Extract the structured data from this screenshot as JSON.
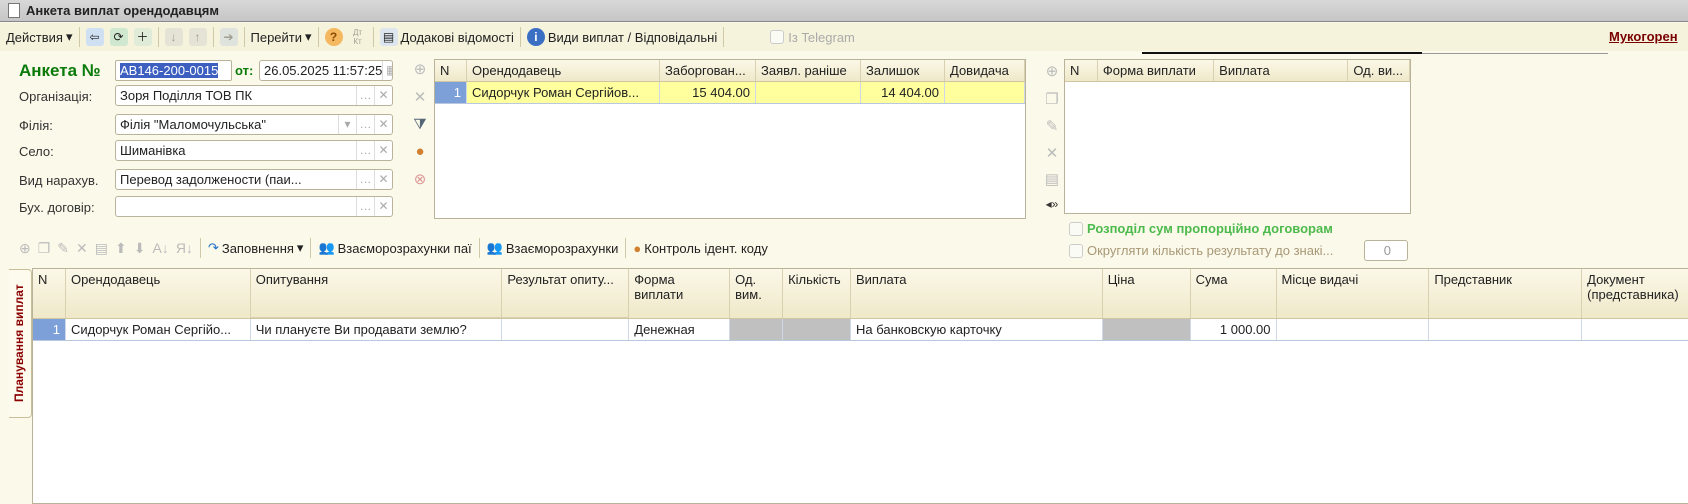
{
  "window": {
    "title": "Анкета виплат орендодавцям"
  },
  "toolbar": {
    "actions": "Действия",
    "goto": "Перейти",
    "dt_kt": "Дт Кт",
    "extra_info": "Додакові відомості",
    "payment_types": "Види виплат / Відповідальні",
    "telegram": "Із Telegram",
    "right_link": "Мукогорен"
  },
  "form": {
    "title": "Анкета №",
    "number": "АВ146-200-0015",
    "date_label": "от:",
    "date": "26.05.2025 11:57:25",
    "fields": [
      {
        "label": "Організація:",
        "value": "Зоря Поділля ТОВ ПК"
      },
      {
        "label": "Філія:",
        "value": "Філія \"Маломочульська\""
      },
      {
        "label": "Село:",
        "value": "Шиманівка"
      },
      {
        "label": "Вид нарахув.",
        "value": "Перевод задолжености (паи..."
      },
      {
        "label": "Бух. договір:",
        "value": ""
      }
    ]
  },
  "top_table": {
    "columns": [
      "N",
      "Орендодавець",
      "Заборгован...",
      "Заявл. раніше",
      "Залишок",
      "Довидача"
    ],
    "rows": [
      [
        "1",
        "Сидорчук Роман Сергійов...",
        "15 404.00",
        "",
        "14 404.00",
        ""
      ]
    ]
  },
  "right_table": {
    "columns": [
      "N",
      "Форма виплати",
      "Виплата",
      "Од. ви..."
    ],
    "rows": []
  },
  "options": {
    "distribute": "Розподіл сум пропорційно договорам",
    "round": "Округляти кількість результату до знакі...",
    "round_digits": "0"
  },
  "lower_toolbar": {
    "fill": "Заповнення",
    "mutual_shares": "Взаєморозрахунки паї",
    "mutual": "Взаєморозрахунки",
    "id_check": "Контроль ідент. коду"
  },
  "side_tab": "Планування виплат",
  "main_table": {
    "columns": [
      "N",
      "Орендодавець",
      "Опитування",
      "Результат опиту...",
      "Форма виплати",
      "Од. вим.",
      "Кількість",
      "Виплата",
      "Ціна",
      "Сума",
      "Місце видачі",
      "Представник",
      "Документ (представника)"
    ],
    "rows": [
      [
        "1",
        "Сидорчук Роман Сергійо...",
        "Чи плануєте Ви продавати землю?",
        "",
        "Денежная",
        "",
        "",
        "На банковскую карточку",
        "",
        "1 000.00",
        "",
        "",
        ""
      ]
    ]
  },
  "colors": {
    "background": "#fbf9e9",
    "selected_row": "#ffff9e",
    "selected_cell": "#7da0d8",
    "title_green": "#0a7a0a",
    "link": "#7a0000"
  }
}
